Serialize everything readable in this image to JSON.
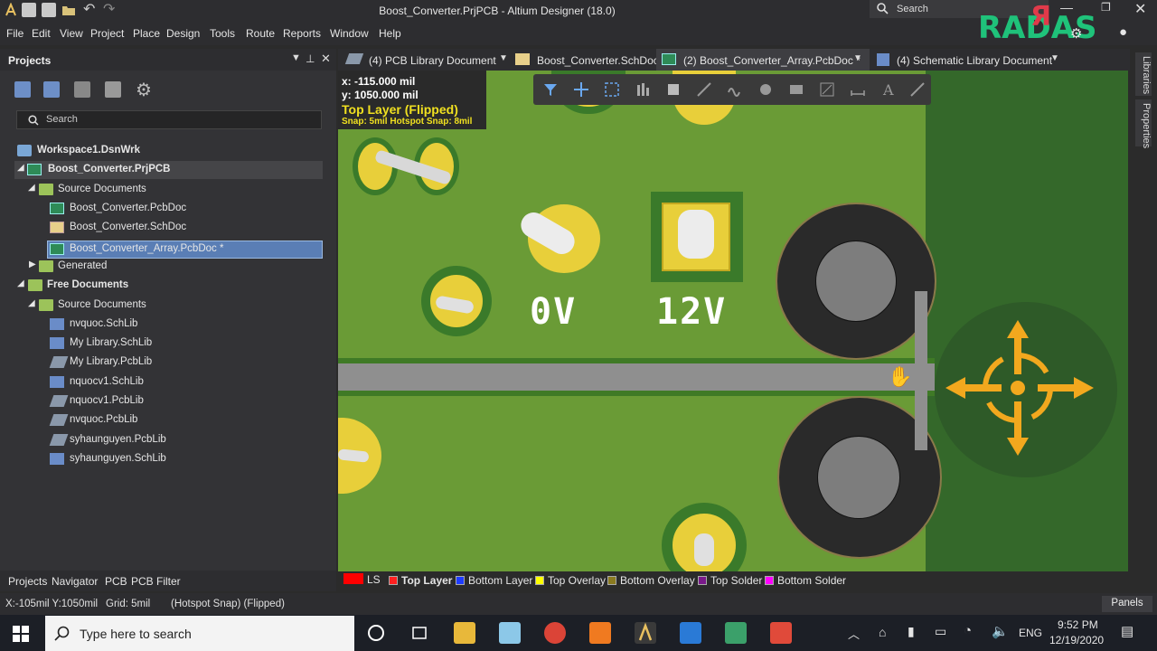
{
  "app": {
    "title": "Boost_Converter.PrjPCB - Altium Designer (18.0)",
    "search_label": "Search"
  },
  "menu": [
    "File",
    "Edit",
    "View",
    "Project",
    "Place",
    "Design",
    "Tools",
    "Route",
    "Reports",
    "Window",
    "Help"
  ],
  "projects_panel": {
    "title": "Projects",
    "search_placeholder": "Search",
    "tree": [
      {
        "label": "Workspace1.DsnWrk",
        "icon": "workspace-icon",
        "bold": true
      },
      {
        "label": "Boost_Converter.PrjPCB",
        "icon": "project-icon",
        "bold": true
      },
      {
        "label": "Source Documents",
        "icon": "folder-icon"
      },
      {
        "label": "Boost_Converter.PcbDoc",
        "icon": "pcbdoc-icon"
      },
      {
        "label": "Boost_Converter.SchDoc",
        "icon": "schdoc-icon"
      },
      {
        "label": "Boost_Converter_Array.PcbDoc *",
        "icon": "pcbdoc-icon",
        "selected": true
      },
      {
        "label": "Generated",
        "icon": "folder-icon"
      },
      {
        "label": "Free Documents",
        "icon": "folder-icon",
        "bold": true
      },
      {
        "label": "Source Documents",
        "icon": "folder-icon"
      },
      {
        "label": "nvquoc.SchLib",
        "icon": "schlib-icon"
      },
      {
        "label": "My Library.SchLib",
        "icon": "schlib-icon"
      },
      {
        "label": "My Library.PcbLib",
        "icon": "pcblib-icon"
      },
      {
        "label": "nquocv1.SchLib",
        "icon": "schlib-icon"
      },
      {
        "label": "nquocv1.PcbLib",
        "icon": "pcblib-icon"
      },
      {
        "label": "nvquoc.PcbLib",
        "icon": "pcblib-icon"
      },
      {
        "label": "syhaunguyen.PcbLib",
        "icon": "pcblib-icon"
      },
      {
        "label": "syhaunguyen.SchLib",
        "icon": "schlib-icon"
      }
    ],
    "bottom_tabs": [
      "Projects",
      "Navigator",
      "PCB",
      "PCB Filter"
    ]
  },
  "doc_tabs": [
    {
      "label": "(4) PCB Library Document"
    },
    {
      "label": "Boost_Converter.SchDoc"
    },
    {
      "label": "(2) Boost_Converter_Array.PcbDoc *",
      "active": true
    },
    {
      "label": "(4) Schematic Library Document"
    }
  ],
  "canvas": {
    "coord_x": "x: -115.000  mil",
    "coord_y": "y: 1050.000  mil",
    "layer_label": "Top Layer (Flipped)",
    "snap_label": "Snap: 5mil Hotspot Snap: 8mil",
    "silk_0v": "0V",
    "silk_12v": "12V",
    "board_color": "#4d7f2a",
    "pad_color": "#e8cf3a"
  },
  "right_panels": [
    "Libraries",
    "Properties"
  ],
  "layers": [
    {
      "label": "LS",
      "color": "#ff0000"
    },
    {
      "label": "Top Layer",
      "color": "#ff2020",
      "active": true
    },
    {
      "label": "Bottom Layer",
      "color": "#1e3cff"
    },
    {
      "label": "Top Overlay",
      "color": "#ffff00"
    },
    {
      "label": "Bottom Overlay",
      "color": "#8a7a20"
    },
    {
      "label": "Top Solder",
      "color": "#7a1a8a"
    },
    {
      "label": "Bottom Solder",
      "color": "#ff00ff"
    }
  ],
  "status": {
    "coords": "X:-105mil Y:1050mil",
    "grid": "Grid: 5mil",
    "snap": "(Hotspot Snap) (Flipped)",
    "panels_button": "Panels"
  },
  "taskbar": {
    "search_placeholder": "Type here to search",
    "lang": "ENG",
    "time": "9:52 PM",
    "date": "12/19/2020"
  }
}
